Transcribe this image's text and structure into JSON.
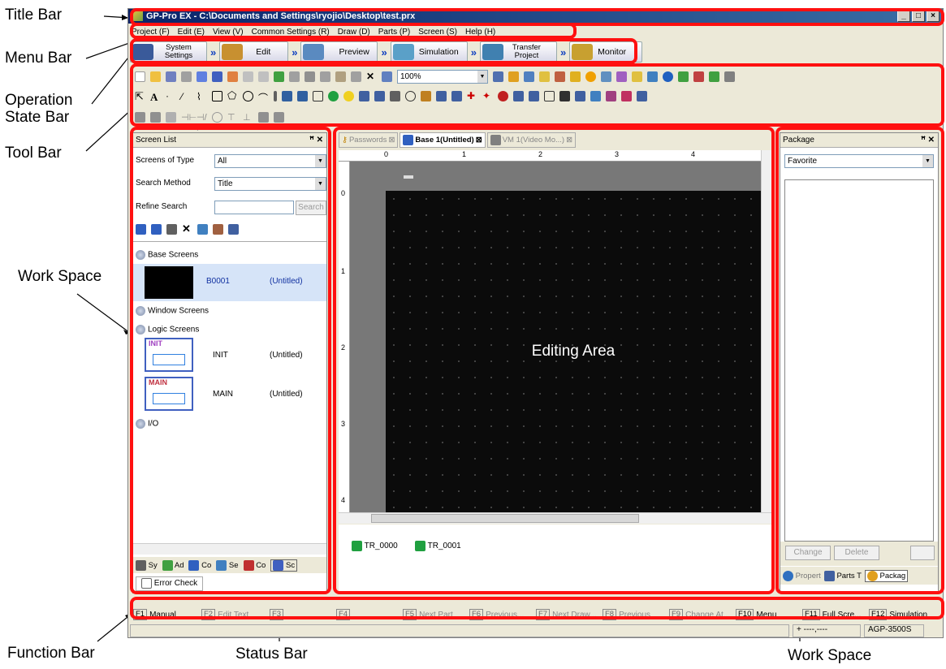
{
  "title_bar": {
    "title": "GP-Pro EX - C:\\Documents and Settings\\ryojio\\Desktop\\test.prx"
  },
  "menu": [
    "Project (F)",
    "Edit (E)",
    "View (V)",
    "Common Settings (R)",
    "Draw (D)",
    "Parts (P)",
    "Screen (S)",
    "Help (H)"
  ],
  "operation_state": [
    {
      "label": "System Settings",
      "icon": "system-settings-icon",
      "color": "#3a5a9a"
    },
    {
      "label": "Edit",
      "icon": "palette-icon",
      "color": "#c89030"
    },
    {
      "label": "Preview",
      "icon": "magnifier-icon",
      "color": "#5a8ac0"
    },
    {
      "label": "Simulation",
      "icon": "simulation-icon",
      "color": "#5aa0c8"
    },
    {
      "label": "Transfer Project",
      "icon": "transfer-icon",
      "color": "#4080b0"
    },
    {
      "label": "Monitor",
      "icon": "monitor-icon",
      "color": "#c8a030"
    }
  ],
  "toolbar": {
    "zoom": "100%"
  },
  "screen_list": {
    "title": "Screen List",
    "type_label": "Screens of Type",
    "type_value": "All",
    "method_label": "Search Method",
    "method_value": "Title",
    "refine_label": "Refine Search",
    "search_button": "Search",
    "base_header": "Base Screens",
    "base_item": {
      "id": "B0001",
      "title": "(Untitled)"
    },
    "window_header": "Window Screens",
    "logic_header": "Logic Screens",
    "logic_items": [
      {
        "thumb": "INIT",
        "name": "INIT",
        "title": "(Untitled)"
      },
      {
        "thumb": "MAIN",
        "name": "MAIN",
        "title": "(Untitled)"
      }
    ],
    "io_header": "I/O",
    "bottom_tabs": [
      "Sy",
      "Ad",
      "Co",
      "Se",
      "Co",
      "Sc"
    ],
    "error_check": "Error Check"
  },
  "editor": {
    "tabs": [
      "Passwords",
      "Base 1(Untitled)",
      "VM 1(Video Mo...)"
    ],
    "ruler_top": [
      "0",
      "1",
      "2",
      "3",
      "4"
    ],
    "ruler_left": [
      "0",
      "1",
      "2",
      "3",
      "4"
    ],
    "editing_area": "Editing Area",
    "transitions": [
      "TR_0000",
      "TR_0001"
    ]
  },
  "package": {
    "title": "Package",
    "select": "Favorite",
    "change": "Change",
    "delete": "Delete",
    "tabs": [
      "Propert",
      "Parts T",
      "Packag"
    ]
  },
  "function_bar": [
    {
      "key": "F1",
      "label": "Manual",
      "on": true
    },
    {
      "key": "F2",
      "label": "Edit Text",
      "on": false
    },
    {
      "key": "F3",
      "label": "",
      "on": false
    },
    {
      "key": "F4",
      "label": "",
      "on": false
    },
    {
      "key": "F5",
      "label": "Next Part",
      "on": false
    },
    {
      "key": "F6",
      "label": "Previous...",
      "on": false
    },
    {
      "key": "F7",
      "label": "Next Draw...",
      "on": false
    },
    {
      "key": "F8",
      "label": "Previous",
      "on": false
    },
    {
      "key": "F9",
      "label": "Change At...",
      "on": false
    },
    {
      "key": "F10",
      "label": "Menu",
      "on": true
    },
    {
      "key": "F11",
      "label": "Full Scre...",
      "on": true
    },
    {
      "key": "F12",
      "label": "Simulation",
      "on": true
    }
  ],
  "status_bar": {
    "coords": "----,----",
    "model": "AGP-3500S"
  },
  "callouts": {
    "title_bar": "Title Bar",
    "menu_bar": "Menu Bar",
    "operation_state_bar": "Operation State Bar",
    "tool_bar": "Tool Bar",
    "work_space_left": "Work Space",
    "function_bar": "Function Bar",
    "status_bar": "Status Bar",
    "work_space_right": "Work Space"
  },
  "highlight_color": "#ff1010"
}
